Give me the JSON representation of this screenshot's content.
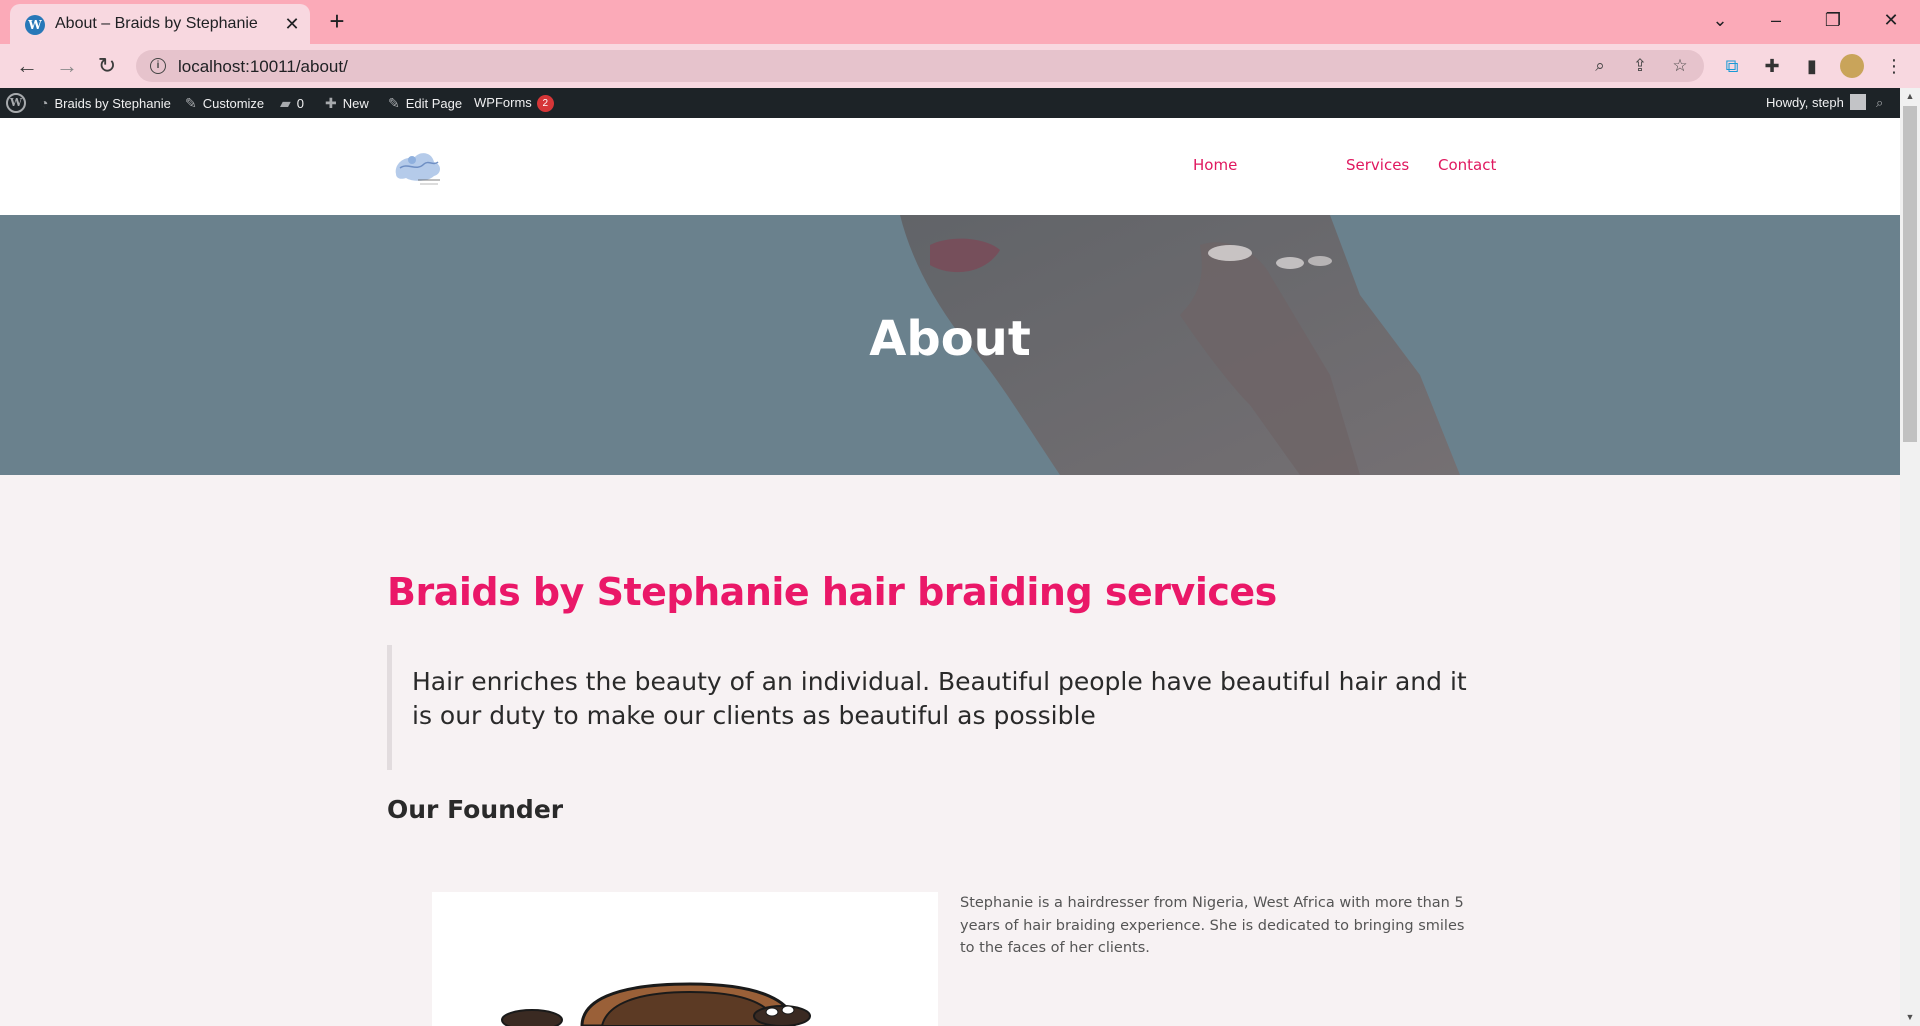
{
  "browser": {
    "tab": {
      "title": "About – Braids by Stephanie",
      "favicon": "wordpress-icon"
    },
    "url": "localhost:10011/about/",
    "colors": {
      "tabstrip": "#fbaab8",
      "toolbar": "#f8d8e0",
      "omnibox": "#e6c3cc"
    }
  },
  "adminbar": {
    "site_name": "Braids by Stephanie",
    "customize": "Customize",
    "comments_count": "0",
    "new": "New",
    "edit_page": "Edit Page",
    "wpforms": "WPForms",
    "wpforms_badge": "2",
    "howdy": "Howdy, steph"
  },
  "site": {
    "nav": [
      {
        "label": "Home"
      },
      {
        "label": "Services"
      },
      {
        "label": "Contact"
      }
    ],
    "accent": "#ea1868"
  },
  "hero": {
    "title": "About"
  },
  "content": {
    "heading": "Braids by Stephanie hair braiding services",
    "quote": "Hair enriches the beauty of an individual. Beautiful people have beautiful hair and it is our duty to make our clients as beautiful as possible",
    "founder_heading": "Our Founder",
    "founder_bio": "Stephanie is a hairdresser from Nigeria, West Africa with more than 5 years of hair braiding experience. She is dedicated to bringing smiles to the faces of her clients."
  }
}
